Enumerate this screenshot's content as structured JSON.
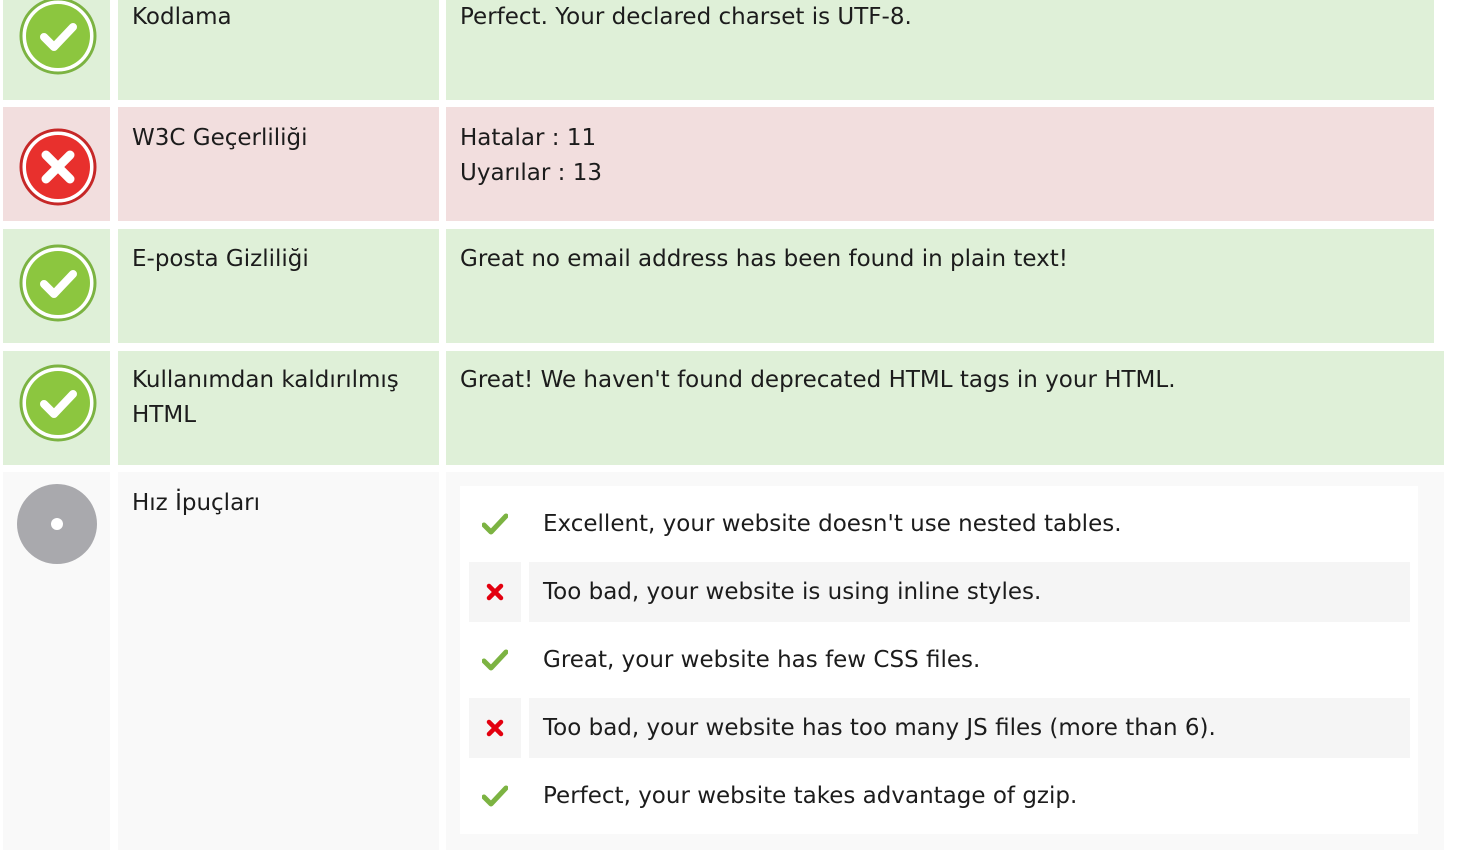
{
  "rows": [
    {
      "label": "Kodlama",
      "status": "ok",
      "values": [
        "Perfect. Your declared charset is UTF-8."
      ]
    },
    {
      "label": "W3C Geçerliliği",
      "status": "error",
      "values": [
        "Hatalar : 11",
        "Uyarılar : 13"
      ]
    },
    {
      "label": "E-posta Gizliliği",
      "status": "ok",
      "values": [
        "Great no email address has been found in plain text!"
      ]
    },
    {
      "label": "Kullanımdan kaldırılmış HTML",
      "status": "ok",
      "values": [
        "Great! We haven't found deprecated HTML tags in your HTML."
      ]
    },
    {
      "label": "Hız İpuçları",
      "status": "neutral",
      "values": []
    }
  ],
  "speed_tips": [
    {
      "status": "ok",
      "text": "Excellent, your website doesn't use nested tables."
    },
    {
      "status": "error",
      "text": "Too bad, your website is using inline styles."
    },
    {
      "status": "ok",
      "text": "Great, your website has few CSS files."
    },
    {
      "status": "error",
      "text": "Too bad, your website has too many JS files (more than 6)."
    },
    {
      "status": "ok",
      "text": "Perfect, your website takes advantage of gzip."
    }
  ],
  "icons": {
    "ok": "check-circle-icon",
    "error": "cross-circle-icon",
    "neutral": "dot-circle-icon",
    "tip_ok": "check-icon",
    "tip_error": "cross-icon"
  },
  "colors": {
    "ok_bg": "#dff0d8",
    "error_bg": "#f2dede",
    "neutral_bg": "#f9f9f9",
    "ok_accent": "#8cc63f",
    "error_accent": "#e8302d",
    "tip_error": "#e3000f"
  }
}
